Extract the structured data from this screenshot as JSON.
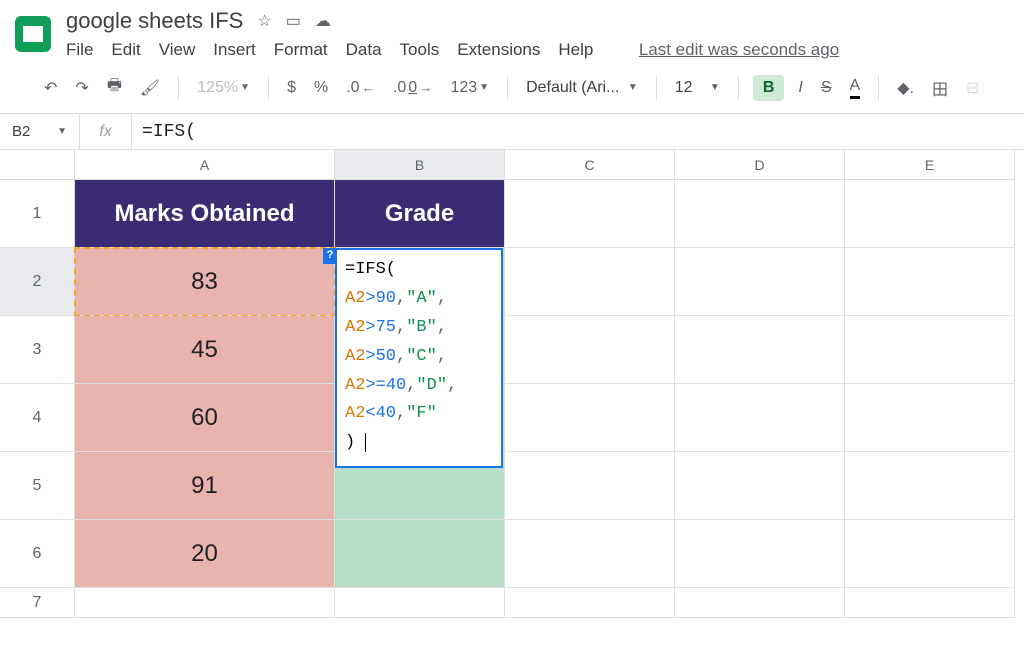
{
  "doc_title": "google sheets IFS",
  "menus": [
    "File",
    "Edit",
    "View",
    "Insert",
    "Format",
    "Data",
    "Tools",
    "Extensions",
    "Help"
  ],
  "last_edit": "Last edit was seconds ago",
  "toolbar": {
    "zoom": "125%",
    "currency": "$",
    "percent": "%",
    "dec_dec": ".0",
    "inc_dec": ".00",
    "more_fmt": "123",
    "font_name": "Default (Ari...",
    "font_size": "12",
    "bold": "B",
    "italic": "I",
    "strike": "S",
    "text_color": "A"
  },
  "name_box": "B2",
  "fx": "fx",
  "formula_bar": "=IFS(",
  "columns": [
    "A",
    "B",
    "C",
    "D",
    "E"
  ],
  "rows": [
    "1",
    "2",
    "3",
    "4",
    "5",
    "6",
    "7"
  ],
  "headers": {
    "a": "Marks Obtained",
    "b": "Grade"
  },
  "marks": [
    "83",
    "45",
    "60",
    "91",
    "20"
  ],
  "formula_popup": {
    "help": "?",
    "lines": [
      {
        "pre": "=IFS(",
        "ref": "",
        "op": "",
        "num": "",
        "comma": "",
        "str": "",
        "comma2": ""
      },
      {
        "ref": "A2",
        "op": ">",
        "num": "90",
        "comma": ",",
        "str": "\"A\"",
        "comma2": ","
      },
      {
        "ref": "A2",
        "op": ">",
        "num": "75",
        "comma": ",",
        "str": "\"B\"",
        "comma2": ","
      },
      {
        "ref": "A2",
        "op": ">",
        "num": "50",
        "comma": ",",
        "str": "\"C\"",
        "comma2": ","
      },
      {
        "ref": "A2",
        "op": ">=",
        "num": "40",
        "comma": ",",
        "str": "\"D\"",
        "comma2": ","
      },
      {
        "ref": "A2",
        "op": "<",
        "num": "40",
        "comma": ",",
        "str": "\"F\"",
        "comma2": ""
      }
    ],
    "close": ")"
  }
}
